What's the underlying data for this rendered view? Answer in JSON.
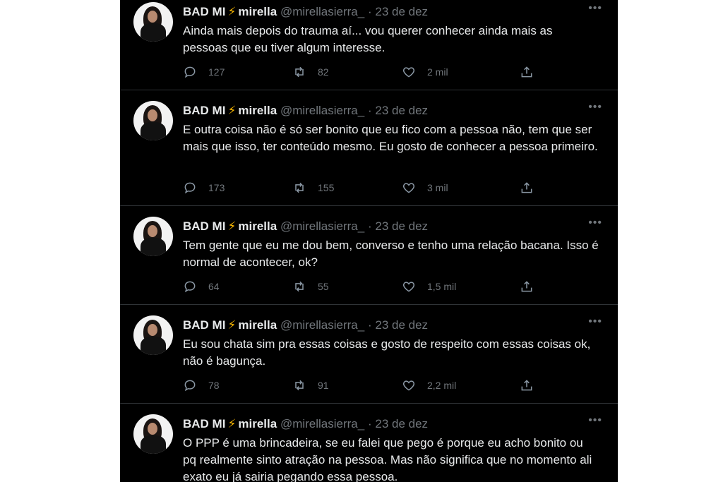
{
  "tweets": [
    {
      "display_name": "BAD MI",
      "bolt": "⚡",
      "name2": "mirella",
      "handle": "@mirellasierra_",
      "sep": "·",
      "date": "23 de dez",
      "more": "•••",
      "text": "Ainda mais depois do trauma aí... vou querer conhecer ainda mais as pessoas que eu tiver algum interesse.",
      "replies": "127",
      "retweets": "82",
      "likes": "2 mil"
    },
    {
      "display_name": "BAD MI",
      "bolt": "⚡",
      "name2": "mirella",
      "handle": "@mirellasierra_",
      "sep": "·",
      "date": "23 de dez",
      "more": "•••",
      "text": "E outra coisa não é só ser bonito que eu fico com a pessoa não, tem que ser mais que isso, ter conteúdo mesmo. Eu gosto de conhecer a pessoa primeiro.",
      "replies": "173",
      "retweets": "155",
      "likes": "3 mil"
    },
    {
      "display_name": "BAD MI",
      "bolt": "⚡",
      "name2": "mirella",
      "handle": "@mirellasierra_",
      "sep": "·",
      "date": "23 de dez",
      "more": "•••",
      "text": "Tem gente que eu me dou bem, converso e tenho uma relação bacana. Isso é normal de acontecer, ok?",
      "replies": "64",
      "retweets": "55",
      "likes": "1,5 mil"
    },
    {
      "display_name": "BAD MI",
      "bolt": "⚡",
      "name2": "mirella",
      "handle": "@mirellasierra_",
      "sep": "·",
      "date": "23 de dez",
      "more": "•••",
      "text": "Eu sou chata sim pra essas coisas e gosto de respeito com essas coisas ok, não é bagunça.",
      "replies": "78",
      "retweets": "91",
      "likes": "2,2 mil"
    },
    {
      "display_name": "BAD MI",
      "bolt": "⚡",
      "name2": "mirella",
      "handle": "@mirellasierra_",
      "sep": "·",
      "date": "23 de dez",
      "more": "•••",
      "text": "O PPP é uma brincadeira, se eu falei que pego é porque eu acho bonito ou pq realmente sinto atração na pessoa. Mas não significa que no momento ali exato eu já sairia pegando essa pessoa.",
      "replies": "",
      "retweets": "",
      "likes": ""
    }
  ],
  "colors": {
    "background": "#000000",
    "text": "#e7e9ea",
    "muted": "#71767b",
    "bolt": "#f4b400",
    "divider": "#2f3336"
  },
  "icons": [
    "reply-icon",
    "retweet-icon",
    "like-icon",
    "share-icon",
    "more-icon"
  ]
}
